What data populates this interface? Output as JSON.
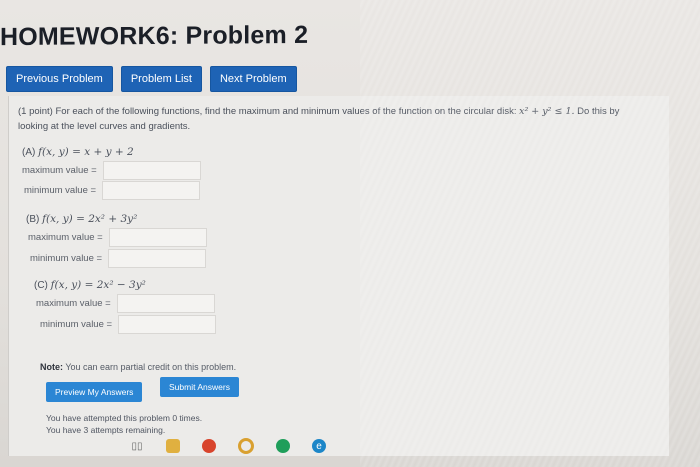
{
  "page": {
    "title": "HOMEWORK6: Problem 2"
  },
  "nav": {
    "prev": "Previous Problem",
    "list": "Problem List",
    "next": "Next Problem"
  },
  "problem": {
    "intro_1": "(1 point) For each of the following functions, find the maximum and minimum values of the function on the circular disk:",
    "disk": "x² + y² ≤ 1.",
    "intro_2": "Do this by",
    "intro_3": "looking at the level curves and gradients.",
    "parts": [
      {
        "label": "(A)",
        "expr": "f(x, y) = x + y + 2",
        "max_label": "maximum value =",
        "min_label": "minimum value =",
        "max_value": "",
        "min_value": ""
      },
      {
        "label": "(B)",
        "expr": "f(x, y) = 2x² + 3y²",
        "max_label": "maximum value =",
        "min_label": "minimum value =",
        "max_value": "",
        "min_value": ""
      },
      {
        "label": "(C)",
        "expr": "f(x, y) = 2x² − 3y²",
        "max_label": "maximum value =",
        "min_label": "minimum value =",
        "max_value": "",
        "min_value": ""
      }
    ]
  },
  "note": {
    "label": "Note:",
    "text": "You can earn partial credit on this problem."
  },
  "actions": {
    "preview": "Preview My Answers",
    "submit": "Submit Answers"
  },
  "attempts": {
    "line1": "You have attempted this problem 0 times.",
    "line2": "You have 3 attempts remaining."
  },
  "colors": {
    "nav_button": "#1e63b5",
    "action_button": "#2b86d4",
    "title": "#1b1f27"
  },
  "taskbar": {
    "icons": [
      "task-view-icon",
      "folder-icon",
      "office-icon",
      "chrome-icon",
      "app-green-icon",
      "edge-icon"
    ]
  }
}
